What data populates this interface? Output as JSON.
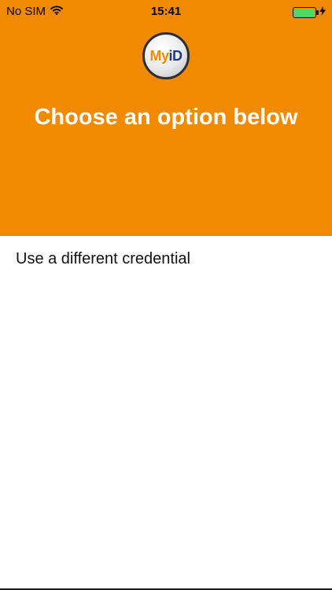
{
  "status_bar": {
    "carrier": "No SIM",
    "wifi_icon": "wifi-icon",
    "time": "15:41",
    "battery_color": "#4cd964",
    "charging_icon": "bolt-icon"
  },
  "header": {
    "background": "#f28a00",
    "logo": {
      "part1": "My",
      "part2": "iD"
    },
    "title": "Choose an option below"
  },
  "options": [
    {
      "label": "Use a different credential"
    }
  ]
}
